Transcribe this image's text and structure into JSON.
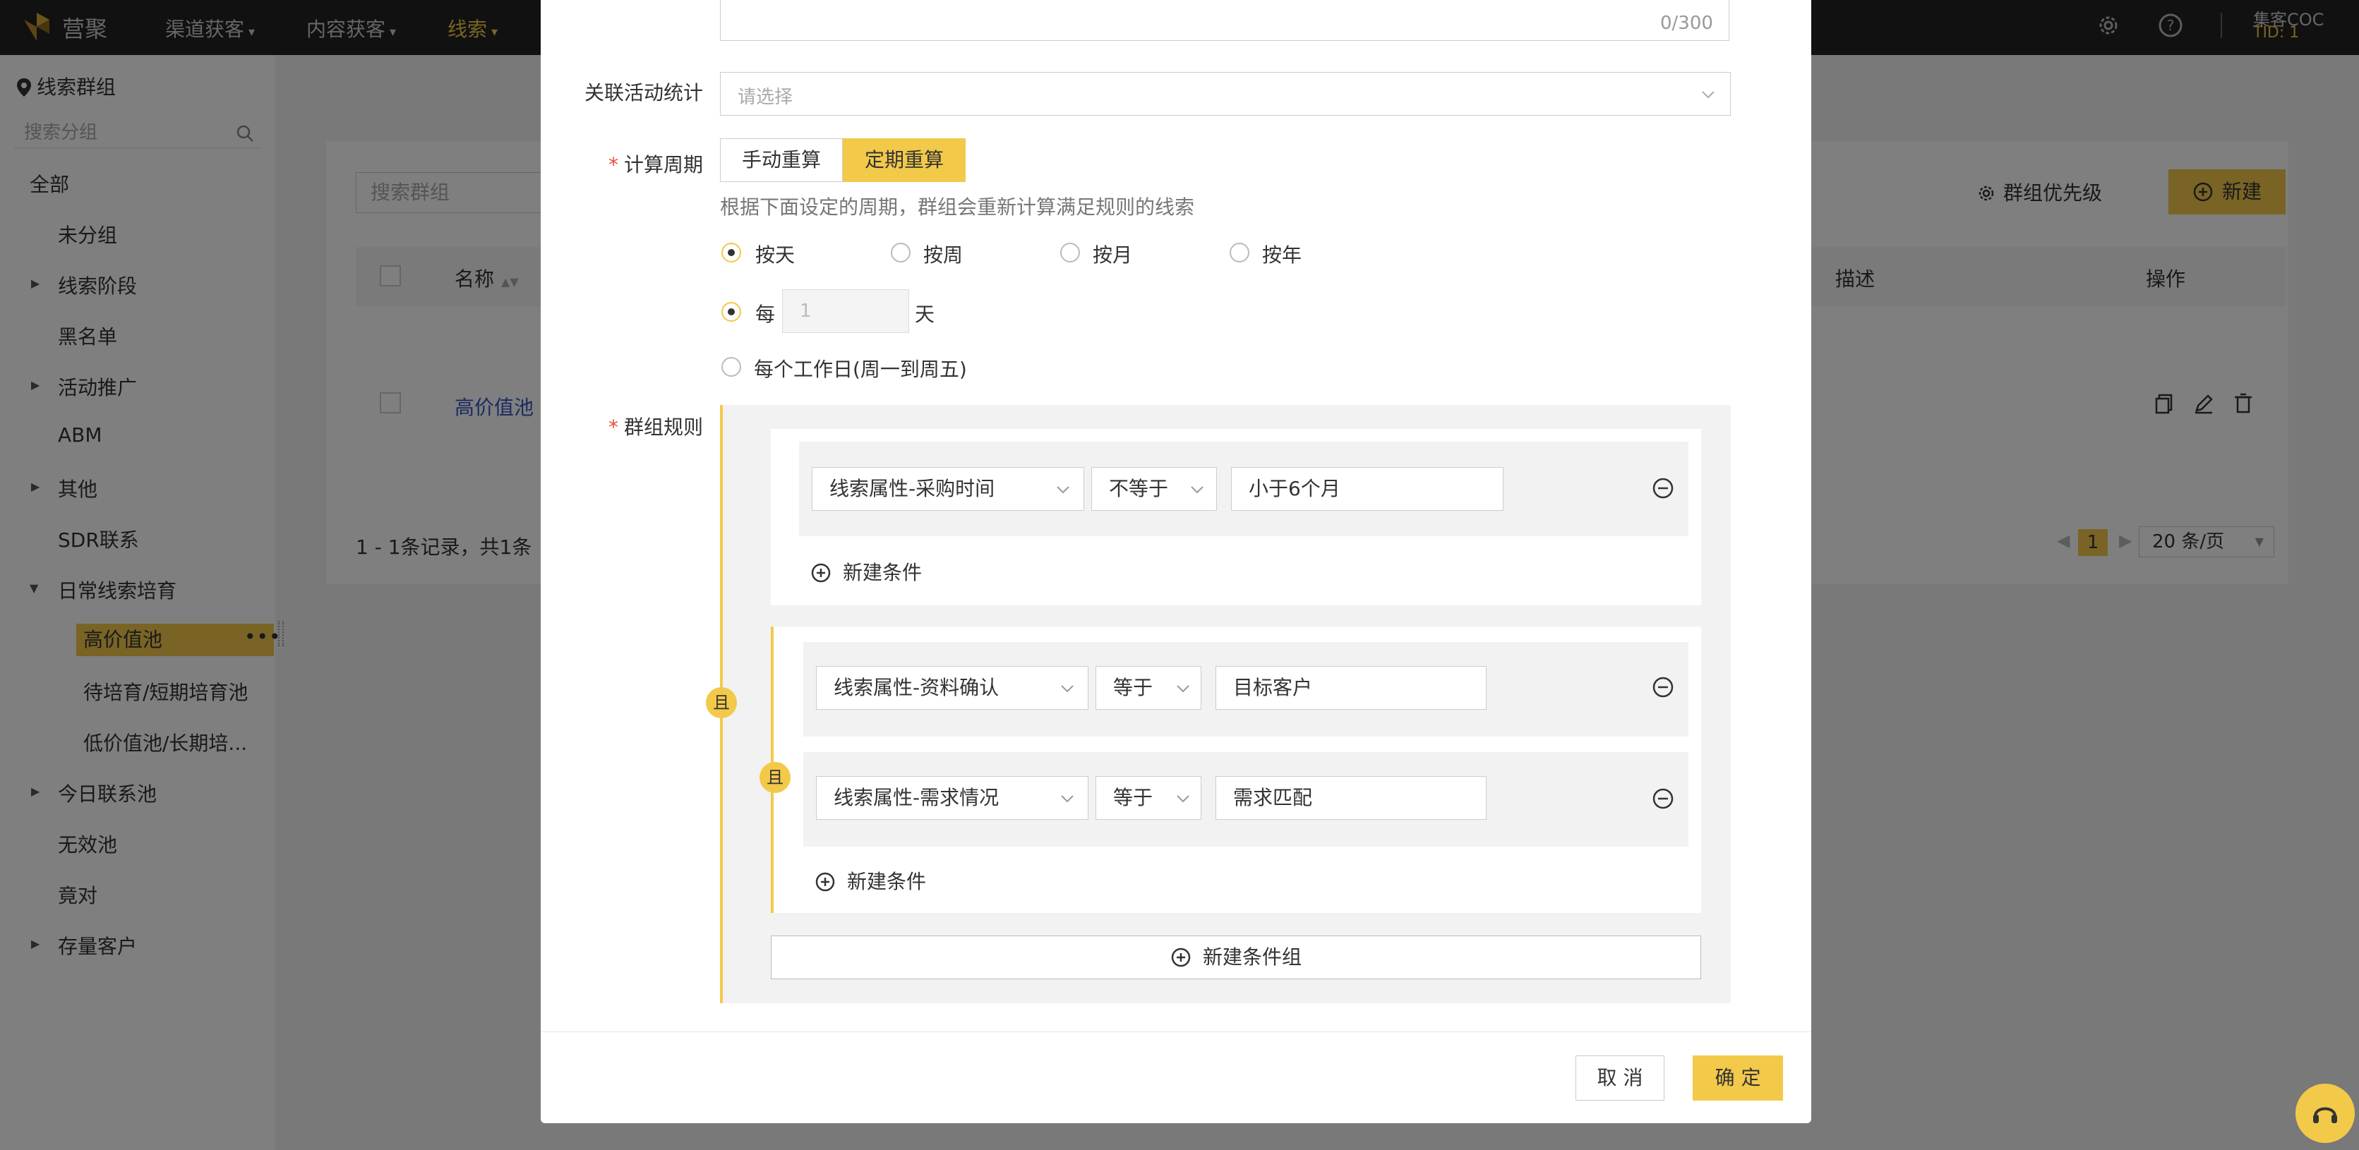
{
  "topbar": {
    "brand": "营聚",
    "nav": [
      {
        "label": "渠道获客"
      },
      {
        "label": "内容获客"
      },
      {
        "label": "线索"
      }
    ],
    "user_name": "集客COC",
    "user_tid": "TID: 1"
  },
  "sidebar": {
    "title": "线索群组",
    "search_placeholder": "搜索分组",
    "items": [
      {
        "label": "全部"
      },
      {
        "label": "未分组"
      },
      {
        "label": "线索阶段"
      },
      {
        "label": "黑名单"
      },
      {
        "label": "活动推广"
      },
      {
        "label": "ABM"
      },
      {
        "label": "其他"
      },
      {
        "label": "SDR联系"
      },
      {
        "label": "日常线索培育"
      },
      {
        "label": "高价值池"
      },
      {
        "label": "待培育/短期培育池"
      },
      {
        "label": "低价值池/长期培..."
      },
      {
        "label": "今日联系池"
      },
      {
        "label": "无效池"
      },
      {
        "label": "竟对"
      },
      {
        "label": "存量客户"
      }
    ]
  },
  "main": {
    "search_placeholder": "搜索群组",
    "priority_label": "群组优先级",
    "new_label": "新建",
    "columns": {
      "name": "名称",
      "desc": "描述",
      "ops": "操作"
    },
    "row_name": "高价值池",
    "records": "1 - 1条记录，共1条",
    "page": "1",
    "page_size": "20 条/页"
  },
  "modal": {
    "counter": "0/300",
    "related_label": "关联活动统计",
    "related_placeholder": "请选择",
    "cycle_label": "计算周期",
    "seg_manual": "手动重算",
    "seg_periodic": "定期重算",
    "hint": "根据下面设定的周期，群组会重新计算满足规则的线索",
    "period_options": [
      {
        "label": "按天"
      },
      {
        "label": "按周"
      },
      {
        "label": "按月"
      },
      {
        "label": "按年"
      }
    ],
    "every_label": "每",
    "every_value": "1",
    "day_unit": "天",
    "workday_label": "每个工作日(周一到周五)",
    "rules_label": "群组规则",
    "and_label": "且",
    "group1": {
      "conditions": [
        {
          "field": "线索属性-采购时间",
          "op": "不等于",
          "value": "小于6个月"
        }
      ],
      "add_label": "新建条件"
    },
    "group2": {
      "conditions": [
        {
          "field": "线索属性-资料确认",
          "op": "等于",
          "value": "目标客户"
        },
        {
          "field": "线索属性-需求情况",
          "op": "等于",
          "value": "需求匹配"
        }
      ],
      "add_label": "新建条件"
    },
    "add_group_label": "新建条件组",
    "cancel_label": "取 消",
    "ok_label": "确 定"
  },
  "colors": {
    "accent": "#f3c94a",
    "link": "#3456c2",
    "required": "#e74c3c"
  }
}
